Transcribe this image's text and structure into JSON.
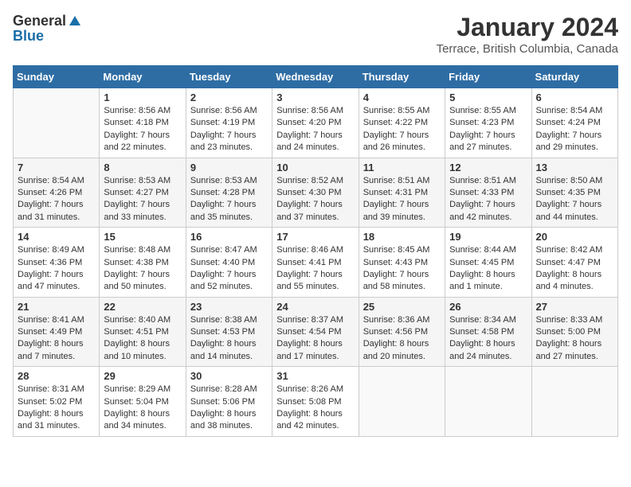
{
  "logo": {
    "general": "General",
    "blue": "Blue"
  },
  "title": "January 2024",
  "location": "Terrace, British Columbia, Canada",
  "days_of_week": [
    "Sunday",
    "Monday",
    "Tuesday",
    "Wednesday",
    "Thursday",
    "Friday",
    "Saturday"
  ],
  "weeks": [
    [
      {
        "day": "",
        "sunrise": "",
        "sunset": "",
        "daylight": ""
      },
      {
        "day": "1",
        "sunrise": "Sunrise: 8:56 AM",
        "sunset": "Sunset: 4:18 PM",
        "daylight": "Daylight: 7 hours and 22 minutes."
      },
      {
        "day": "2",
        "sunrise": "Sunrise: 8:56 AM",
        "sunset": "Sunset: 4:19 PM",
        "daylight": "Daylight: 7 hours and 23 minutes."
      },
      {
        "day": "3",
        "sunrise": "Sunrise: 8:56 AM",
        "sunset": "Sunset: 4:20 PM",
        "daylight": "Daylight: 7 hours and 24 minutes."
      },
      {
        "day": "4",
        "sunrise": "Sunrise: 8:55 AM",
        "sunset": "Sunset: 4:22 PM",
        "daylight": "Daylight: 7 hours and 26 minutes."
      },
      {
        "day": "5",
        "sunrise": "Sunrise: 8:55 AM",
        "sunset": "Sunset: 4:23 PM",
        "daylight": "Daylight: 7 hours and 27 minutes."
      },
      {
        "day": "6",
        "sunrise": "Sunrise: 8:54 AM",
        "sunset": "Sunset: 4:24 PM",
        "daylight": "Daylight: 7 hours and 29 minutes."
      }
    ],
    [
      {
        "day": "7",
        "sunrise": "Sunrise: 8:54 AM",
        "sunset": "Sunset: 4:26 PM",
        "daylight": "Daylight: 7 hours and 31 minutes."
      },
      {
        "day": "8",
        "sunrise": "Sunrise: 8:53 AM",
        "sunset": "Sunset: 4:27 PM",
        "daylight": "Daylight: 7 hours and 33 minutes."
      },
      {
        "day": "9",
        "sunrise": "Sunrise: 8:53 AM",
        "sunset": "Sunset: 4:28 PM",
        "daylight": "Daylight: 7 hours and 35 minutes."
      },
      {
        "day": "10",
        "sunrise": "Sunrise: 8:52 AM",
        "sunset": "Sunset: 4:30 PM",
        "daylight": "Daylight: 7 hours and 37 minutes."
      },
      {
        "day": "11",
        "sunrise": "Sunrise: 8:51 AM",
        "sunset": "Sunset: 4:31 PM",
        "daylight": "Daylight: 7 hours and 39 minutes."
      },
      {
        "day": "12",
        "sunrise": "Sunrise: 8:51 AM",
        "sunset": "Sunset: 4:33 PM",
        "daylight": "Daylight: 7 hours and 42 minutes."
      },
      {
        "day": "13",
        "sunrise": "Sunrise: 8:50 AM",
        "sunset": "Sunset: 4:35 PM",
        "daylight": "Daylight: 7 hours and 44 minutes."
      }
    ],
    [
      {
        "day": "14",
        "sunrise": "Sunrise: 8:49 AM",
        "sunset": "Sunset: 4:36 PM",
        "daylight": "Daylight: 7 hours and 47 minutes."
      },
      {
        "day": "15",
        "sunrise": "Sunrise: 8:48 AM",
        "sunset": "Sunset: 4:38 PM",
        "daylight": "Daylight: 7 hours and 50 minutes."
      },
      {
        "day": "16",
        "sunrise": "Sunrise: 8:47 AM",
        "sunset": "Sunset: 4:40 PM",
        "daylight": "Daylight: 7 hours and 52 minutes."
      },
      {
        "day": "17",
        "sunrise": "Sunrise: 8:46 AM",
        "sunset": "Sunset: 4:41 PM",
        "daylight": "Daylight: 7 hours and 55 minutes."
      },
      {
        "day": "18",
        "sunrise": "Sunrise: 8:45 AM",
        "sunset": "Sunset: 4:43 PM",
        "daylight": "Daylight: 7 hours and 58 minutes."
      },
      {
        "day": "19",
        "sunrise": "Sunrise: 8:44 AM",
        "sunset": "Sunset: 4:45 PM",
        "daylight": "Daylight: 8 hours and 1 minute."
      },
      {
        "day": "20",
        "sunrise": "Sunrise: 8:42 AM",
        "sunset": "Sunset: 4:47 PM",
        "daylight": "Daylight: 8 hours and 4 minutes."
      }
    ],
    [
      {
        "day": "21",
        "sunrise": "Sunrise: 8:41 AM",
        "sunset": "Sunset: 4:49 PM",
        "daylight": "Daylight: 8 hours and 7 minutes."
      },
      {
        "day": "22",
        "sunrise": "Sunrise: 8:40 AM",
        "sunset": "Sunset: 4:51 PM",
        "daylight": "Daylight: 8 hours and 10 minutes."
      },
      {
        "day": "23",
        "sunrise": "Sunrise: 8:38 AM",
        "sunset": "Sunset: 4:53 PM",
        "daylight": "Daylight: 8 hours and 14 minutes."
      },
      {
        "day": "24",
        "sunrise": "Sunrise: 8:37 AM",
        "sunset": "Sunset: 4:54 PM",
        "daylight": "Daylight: 8 hours and 17 minutes."
      },
      {
        "day": "25",
        "sunrise": "Sunrise: 8:36 AM",
        "sunset": "Sunset: 4:56 PM",
        "daylight": "Daylight: 8 hours and 20 minutes."
      },
      {
        "day": "26",
        "sunrise": "Sunrise: 8:34 AM",
        "sunset": "Sunset: 4:58 PM",
        "daylight": "Daylight: 8 hours and 24 minutes."
      },
      {
        "day": "27",
        "sunrise": "Sunrise: 8:33 AM",
        "sunset": "Sunset: 5:00 PM",
        "daylight": "Daylight: 8 hours and 27 minutes."
      }
    ],
    [
      {
        "day": "28",
        "sunrise": "Sunrise: 8:31 AM",
        "sunset": "Sunset: 5:02 PM",
        "daylight": "Daylight: 8 hours and 31 minutes."
      },
      {
        "day": "29",
        "sunrise": "Sunrise: 8:29 AM",
        "sunset": "Sunset: 5:04 PM",
        "daylight": "Daylight: 8 hours and 34 minutes."
      },
      {
        "day": "30",
        "sunrise": "Sunrise: 8:28 AM",
        "sunset": "Sunset: 5:06 PM",
        "daylight": "Daylight: 8 hours and 38 minutes."
      },
      {
        "day": "31",
        "sunrise": "Sunrise: 8:26 AM",
        "sunset": "Sunset: 5:08 PM",
        "daylight": "Daylight: 8 hours and 42 minutes."
      },
      {
        "day": "",
        "sunrise": "",
        "sunset": "",
        "daylight": ""
      },
      {
        "day": "",
        "sunrise": "",
        "sunset": "",
        "daylight": ""
      },
      {
        "day": "",
        "sunrise": "",
        "sunset": "",
        "daylight": ""
      }
    ]
  ]
}
